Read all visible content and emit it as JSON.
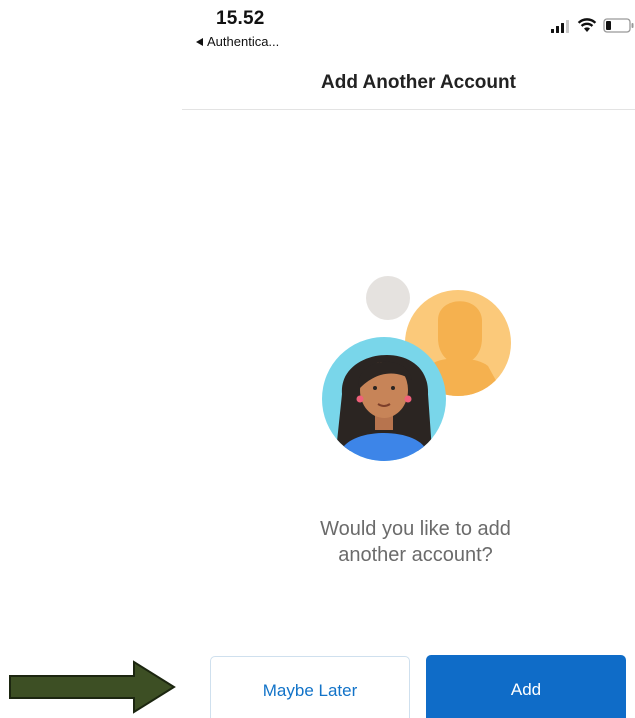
{
  "status_bar": {
    "time": "15.52",
    "back_app": "Authentica..."
  },
  "nav": {
    "title": "Add Another Account"
  },
  "prompt": {
    "line1": "Would you like to add",
    "line2": "another account?"
  },
  "buttons": {
    "maybe_later": "Maybe Later",
    "add": "Add"
  },
  "icons": {
    "signal": "signal-icon",
    "wifi": "wifi-icon",
    "battery": "battery-icon",
    "back": "back-triangle-icon",
    "arrow": "arrow-right-icon"
  },
  "colors": {
    "accent": "#0f6cc8",
    "link": "#1273c8",
    "arrow_fill": "#3d4f24",
    "avatar_front_bg": "#79d6ea",
    "avatar_back_bg": "#fbc97a",
    "dot": "#e5e2df"
  }
}
